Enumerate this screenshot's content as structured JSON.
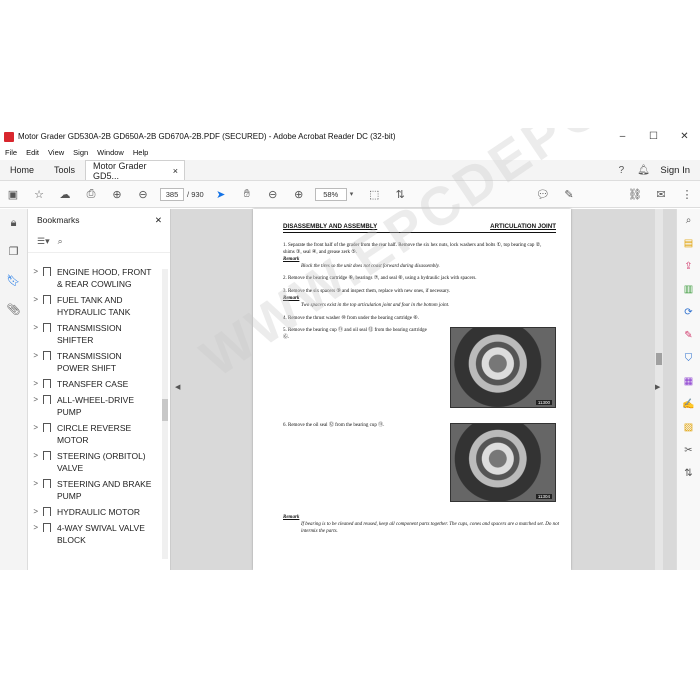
{
  "window": {
    "title": "Motor Grader GD530A-2B GD650A-2B GD670A-2B.PDF (SECURED) - Adobe Acrobat Reader DC (32-bit)",
    "minimize": "–",
    "maximize": "☐",
    "close": "✕"
  },
  "menu": [
    "File",
    "Edit",
    "View",
    "Sign",
    "Window",
    "Help"
  ],
  "tabs": {
    "home": "Home",
    "tools": "Tools",
    "doc": "Motor Grader GD5...",
    "doc_close": "×",
    "sign_in": "Sign In"
  },
  "toolbar": {
    "page_current": "385",
    "page_sep": "/",
    "page_total": "930",
    "zoom": "58%"
  },
  "bookmarks": {
    "title": "Bookmarks",
    "close": "✕",
    "items": [
      "ENGINE HOOD, FRONT & REAR COWLING",
      "FUEL TANK AND HYDRAULIC TANK",
      "TRANSMISSION SHIFTER",
      "TRANSMISSION POWER SHIFT",
      "TRANSFER CASE",
      "ALL-WHEEL-DRIVE PUMP",
      "CIRCLE REVERSE MOTOR",
      "STEERING (ORBITOL) VALVE",
      "STEERING AND BRAKE PUMP",
      "HYDRAULIC MOTOR",
      "4-WAY SWIVAL VALVE BLOCK"
    ]
  },
  "page": {
    "header_left": "DISASSEMBLY AND ASSEMBLY",
    "header_right": "ARTICULATION JOINT",
    "step1": "1.   Separate the front half of the grader from the rear half. Remove the six hex nuts, lock washers and bolts ①, top bearing cap ②, shims ③, seal ④, and grease zerk ⑤.",
    "remark": "Remark",
    "remark1": "Block the tires so the unit does not coast forward during disassembly.",
    "step2": "2.   Remove the bearing cartridge ⑥, bearings ⑦, and seal ⑧, using a hydraulic jack with spacers.",
    "step3": "3.   Remove the six spacers ⑨ and inspect them, replace with new ones, if necessary.",
    "remark2": "Two spacers exist in the top articulation joint and four in the bottom joint.",
    "step4": "4.   Remove the thrust washer ⑩ from under the bearing cartridge ⑥.",
    "step5": "5.   Remove the bearing cup ⑪ and oil seal ⑫ from the bearing cartridge ⑥.",
    "photo1_caption": "11300",
    "step6": "6.   Remove the oil seal ⑫ from the bearing cup ⑪.",
    "photo2_caption": "11304",
    "remark3": "If bearing is to be cleaned and reused, keep all component parts together. The cups, cones and spacers are a matched set. Do not intermix the parts.",
    "watermark": "WWW.EPCDEPO.COM"
  },
  "right_tool_colors": [
    "#2c6fce",
    "#e0a000",
    "#d23c6e",
    "#3a9a3a",
    "#2c6fce",
    "#d23c6e",
    "#2c6fce",
    "#8a3ccf",
    "#6b3ccf",
    "#e0a000",
    "#555555"
  ]
}
